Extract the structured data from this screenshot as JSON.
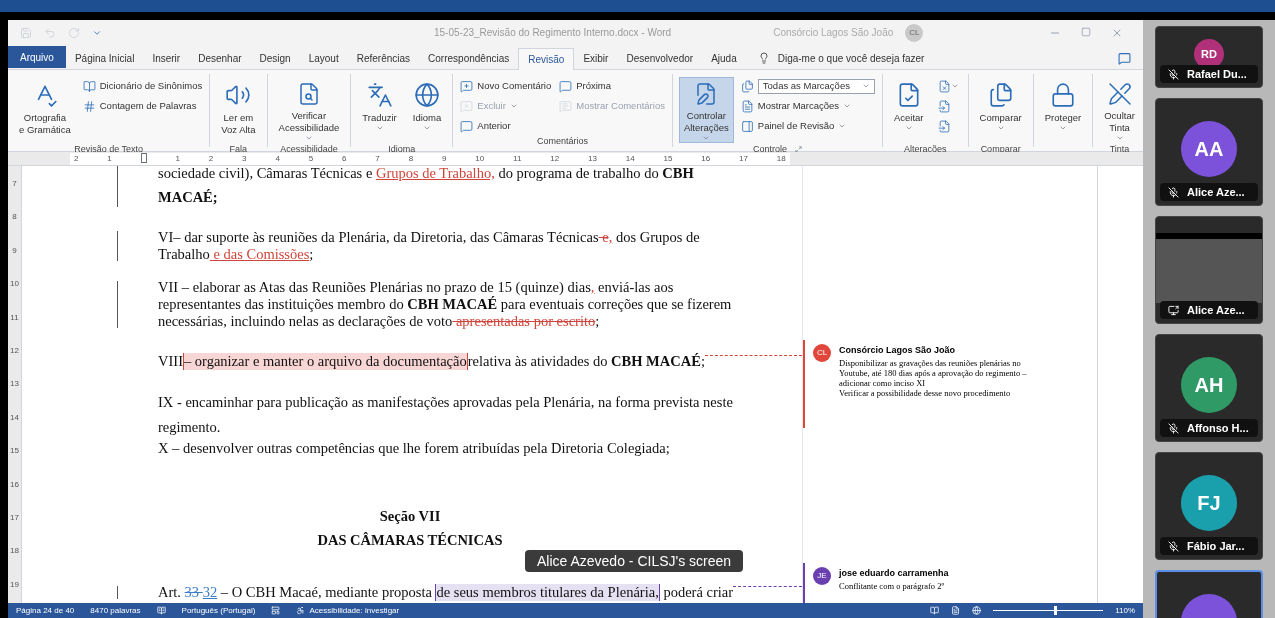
{
  "window": {
    "title": "15-05-23_Revisão do Regimento Interno.docx - Word",
    "account": "Consórcio Lagos São João",
    "account_initials": "CL"
  },
  "tabs": [
    {
      "label": "Arquivo",
      "selected": false,
      "kind": "file"
    },
    {
      "label": "Página Inicial",
      "selected": false,
      "kind": "tab"
    },
    {
      "label": "Inserir",
      "selected": false,
      "kind": "tab"
    },
    {
      "label": "Desenhar",
      "selected": false,
      "kind": "tab"
    },
    {
      "label": "Design",
      "selected": false,
      "kind": "tab"
    },
    {
      "label": "Layout",
      "selected": false,
      "kind": "tab"
    },
    {
      "label": "Referências",
      "selected": false,
      "kind": "tab"
    },
    {
      "label": "Correspondências",
      "selected": false,
      "kind": "tab"
    },
    {
      "label": "Revisão",
      "selected": true,
      "kind": "tab"
    },
    {
      "label": "Exibir",
      "selected": false,
      "kind": "tab"
    },
    {
      "label": "Desenvolvedor",
      "selected": false,
      "kind": "tab"
    },
    {
      "label": "Ajuda",
      "selected": false,
      "kind": "tab"
    }
  ],
  "tell_me": {
    "placeholder": "Diga-me o que você deseja fazer"
  },
  "ribbon": [
    {
      "label": "Revisão de Texto",
      "items": [
        {
          "kind": "large",
          "lines": [
            "Ortografia",
            "e Gramática"
          ],
          "dropdown": false,
          "disabled": false,
          "pressed": false
        },
        {
          "kind": "small",
          "lines": [
            "Dicionário de Sinônimos"
          ],
          "dropdown": false,
          "disabled": false,
          "pressed": false
        },
        {
          "kind": "small",
          "lines": [
            "Contagem de Palavras"
          ],
          "dropdown": false,
          "disabled": false,
          "pressed": false
        }
      ]
    },
    {
      "label": "Fala",
      "items": [
        {
          "kind": "large",
          "lines": [
            "Ler em",
            "Voz Alta"
          ],
          "dropdown": false,
          "disabled": false,
          "pressed": false
        }
      ]
    },
    {
      "label": "Acessibilidade",
      "items": [
        {
          "kind": "large",
          "lines": [
            "Verificar",
            "Acessibilidade"
          ],
          "dropdown": true,
          "disabled": false,
          "pressed": false
        }
      ]
    },
    {
      "label": "Idioma",
      "items": [
        {
          "kind": "large",
          "lines": [
            "Traduzir"
          ],
          "dropdown": true,
          "disabled": false,
          "pressed": false
        },
        {
          "kind": "large",
          "lines": [
            "Idioma"
          ],
          "dropdown": true,
          "disabled": false,
          "pressed": false
        }
      ]
    },
    {
      "label": "Comentários",
      "items": [
        {
          "kind": "small",
          "lines": [
            "Novo Comentário"
          ],
          "dropdown": false,
          "disabled": false,
          "pressed": false
        },
        {
          "kind": "small",
          "lines": [
            "Excluir"
          ],
          "dropdown": true,
          "disabled": true,
          "pressed": false
        },
        {
          "kind": "small",
          "lines": [
            "Anterior"
          ],
          "dropdown": false,
          "disabled": false,
          "pressed": false
        },
        {
          "kind": "small",
          "lines": [
            "Próxima"
          ],
          "dropdown": false,
          "disabled": false,
          "pressed": false
        },
        {
          "kind": "small",
          "lines": [
            "Mostrar Comentários"
          ],
          "dropdown": false,
          "disabled": true,
          "pressed": false
        }
      ]
    },
    {
      "label": "Controle",
      "items": [
        {
          "kind": "large",
          "lines": [
            "Controlar",
            "Alterações"
          ],
          "dropdown": true,
          "disabled": false,
          "pressed": true
        },
        {
          "kind": "select",
          "lines": [
            "Todas as Marcações"
          ],
          "dropdown": true,
          "disabled": false,
          "pressed": false
        },
        {
          "kind": "small",
          "lines": [
            "Mostrar Marcações"
          ],
          "dropdown": true,
          "disabled": false,
          "pressed": false
        },
        {
          "kind": "small",
          "lines": [
            "Painel de Revisão"
          ],
          "dropdown": true,
          "disabled": false,
          "pressed": false
        }
      ]
    },
    {
      "label": "Alterações",
      "items": [
        {
          "kind": "large",
          "lines": [
            "Aceitar"
          ],
          "dropdown": true,
          "disabled": false,
          "pressed": false
        },
        {
          "kind": "icon",
          "dropdown": true,
          "disabled": false,
          "pressed": false
        },
        {
          "kind": "icon",
          "dropdown": false,
          "disabled": false,
          "pressed": false
        },
        {
          "kind": "icon",
          "dropdown": false,
          "disabled": false,
          "pressed": false
        }
      ]
    },
    {
      "label": "Comparar",
      "items": [
        {
          "kind": "large",
          "lines": [
            "Comparar"
          ],
          "dropdown": true,
          "disabled": false,
          "pressed": false
        }
      ]
    },
    {
      "items": [
        {
          "kind": "large",
          "lines": [
            "Proteger"
          ],
          "dropdown": true,
          "disabled": false,
          "pressed": false
        }
      ]
    },
    {
      "label": "Tinta",
      "items": [
        {
          "kind": "large",
          "lines": [
            "Ocultar",
            "Tinta"
          ],
          "dropdown": true,
          "disabled": false,
          "pressed": false
        }
      ]
    }
  ],
  "ruler": [
    "2",
    "1",
    "1",
    "2",
    "3",
    "4",
    "5",
    "6",
    "7",
    "8",
    "9",
    "10",
    "11",
    "12",
    "13",
    "14",
    "15",
    "16",
    "17",
    "18"
  ],
  "vertical_ruler": [
    "7",
    "8",
    "9",
    "10",
    "11",
    "12",
    "13",
    "14",
    "15",
    "16",
    "17",
    "18",
    "19"
  ],
  "document": [
    {
      "kind": "body",
      "change_bar": true,
      "lines": [
        [
          {
            "text": "sociedade civil), Câmaras Técnicas e ",
            "kind": "plain"
          },
          {
            "text": "Grupos de Trabalho,",
            "kind": "ins"
          },
          {
            "text": " do programa de trabalho do ",
            "kind": "plain"
          },
          {
            "text": "CBH",
            "kind": "bold"
          }
        ],
        [
          {
            "text": "MACAÉ;",
            "kind": "bold"
          }
        ]
      ]
    },
    {
      "kind": "body",
      "change_bar": true,
      "lines": [
        [
          {
            "text": "VI– dar suporte às reuniões da Plenária, da Diretoria, das Câmaras Técnicas",
            "kind": "plain"
          },
          {
            "text": " e",
            "kind": "del"
          },
          {
            "text": ",",
            "kind": "ins"
          },
          {
            "text": " dos Grupos de",
            "kind": "plain"
          }
        ],
        [
          {
            "text": "Trabalho",
            "kind": "plain"
          },
          {
            "text": " e das Comissões",
            "kind": "ins"
          },
          {
            "text": ";",
            "kind": "plain"
          }
        ]
      ]
    },
    {
      "kind": "body",
      "change_bar": true,
      "lines": [
        [
          {
            "text": "VII – elaborar as Atas das Reuniões Plenárias no prazo de 15 (quinze) dias",
            "kind": "plain"
          },
          {
            "text": ",",
            "kind": "ins"
          },
          {
            "text": " enviá-las aos",
            "kind": "plain"
          }
        ],
        [
          {
            "text": "representantes das instituições membro do ",
            "kind": "plain"
          },
          {
            "text": "CBH MACAÉ",
            "kind": "bold"
          },
          {
            "text": " para eventuais correções que se fizerem",
            "kind": "plain"
          }
        ],
        [
          {
            "text": "necessárias, incluindo nelas as declarações de voto",
            "kind": "plain"
          },
          {
            "text": " apresentadas por escrito",
            "kind": "del"
          },
          {
            "text": ";",
            "kind": "plain"
          }
        ]
      ]
    },
    {
      "kind": "body",
      "change_bar": false,
      "lines": [
        [
          {
            "text": "VIII",
            "kind": "plain"
          },
          {
            "text": "– organizar e manter o arquivo da documentação",
            "kind": "anchor"
          },
          {
            "text": "relativa às atividades do ",
            "kind": "plain"
          },
          {
            "text": "CBH MACAÉ",
            "kind": "bold"
          },
          {
            "text": ";",
            "kind": "plain"
          }
        ]
      ]
    },
    {
      "kind": "body",
      "change_bar": false,
      "lines": [
        [
          {
            "text": "IX - encaminhar para publicação as manifestações aprovadas pela Plenária, na forma prevista neste",
            "kind": "plain"
          }
        ],
        [
          {
            "text": "regimento.",
            "kind": "plain"
          }
        ]
      ]
    },
    {
      "kind": "body",
      "change_bar": false,
      "lines": [
        [
          {
            "text": "X – desenvolver outras competências que lhe forem atribuídas pela Diretoria Colegiada;",
            "kind": "plain"
          }
        ]
      ]
    },
    {
      "kind": "heading",
      "change_bar": false,
      "lines": [
        [
          {
            "text": "Seção VII",
            "kind": "plain"
          }
        ]
      ]
    },
    {
      "kind": "heading",
      "change_bar": false,
      "lines": [
        [
          {
            "text": "DAS CÂMARAS TÉCNICAS",
            "kind": "plain"
          }
        ]
      ]
    },
    {
      "kind": "body",
      "change_bar": true,
      "lines": [
        [
          {
            "text": "Art. ",
            "kind": "plain"
          },
          {
            "text": "33 ",
            "kind": "del2"
          },
          {
            "text": "32",
            "kind": "ins2"
          },
          {
            "text": " – O CBH Macaé, mediante proposta ",
            "kind": "plain"
          },
          {
            "text": "de seus membros titulares da Plenária,",
            "kind": "anchor2"
          },
          {
            "text": " poderá criar",
            "kind": "plain"
          }
        ]
      ]
    }
  ],
  "comments": [
    {
      "author": "Consórcio Lagos São João",
      "initials": "CL",
      "color": "#e0473a",
      "lines": [
        "Disponibilizar as gravações das reuniões plenárias no",
        "Youtube, até 180 dias após a aprovação do regimento –",
        "adicionar como inciso XI",
        "Verificar a possibilidade desse novo procedimento"
      ]
    },
    {
      "author": "jose eduardo carramenha",
      "initials": "JE",
      "color": "#6a3fb0",
      "lines": [
        "Conflitante com o parágrafo 2º"
      ]
    }
  ],
  "share_label": "Alice Azevedo - CILSJ's screen",
  "status_bar": {
    "page": "Página 24 de 40",
    "words": "8470 palavras",
    "language": "Português (Portugal)",
    "accessibility": "Acessibilidade: investigar",
    "zoom": "110%",
    "zoom_slider": {
      "level": 0.55
    }
  },
  "participants": [
    {
      "kind": "avatar",
      "name": "Rafael Du...",
      "initials": "RD",
      "color": "#b0307a",
      "speaking": false
    },
    {
      "kind": "avatar",
      "name": "Alice Aze...",
      "initials": "AA",
      "color": "#7b52d9",
      "speaking": false
    },
    {
      "kind": "screen",
      "name": "Alice Aze...",
      "speaking": false
    },
    {
      "kind": "avatar",
      "name": "Affonso H...",
      "initials": "AH",
      "color": "#2f9a66",
      "speaking": false
    },
    {
      "kind": "avatar",
      "name": "Fábio Jar...",
      "initials": "FJ",
      "color": "#1aa0ad",
      "speaking": false
    },
    {
      "kind": "avatar",
      "color": "#7b52d9",
      "speaking": true
    }
  ]
}
